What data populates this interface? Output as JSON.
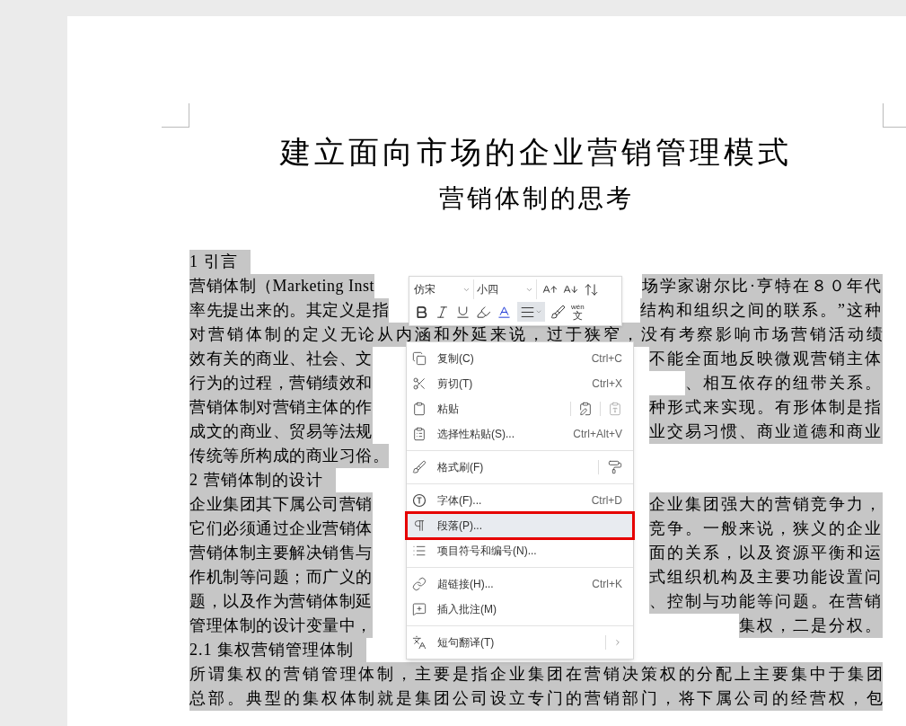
{
  "document": {
    "title": "建立面向市场的企业营销管理模式",
    "subtitle": "营销体制的思考",
    "lines": [
      {
        "kind": "heading",
        "text": "1 引言"
      },
      {
        "kind": "split",
        "left": "营销体制（Marketing Inst",
        "right": "场学家谢尔比·亨特在８０年代"
      },
      {
        "kind": "split",
        "left": "率先提出来的。其定义是指",
        "right": "结构和组织之间的联系。”这种"
      },
      {
        "kind": "full",
        "text": "对营销体制的定义无论从内涵和外延来说，过于狭窄，没有考察影响市场营销活动绩"
      },
      {
        "kind": "split",
        "left": "效有关的商业、社会、文",
        "right": "不能全面地反映微观营销主体"
      },
      {
        "kind": "split",
        "left": "行为的过程，营销绩效和",
        "right": "、相互依存的纽带关系。"
      },
      {
        "kind": "split",
        "left": "营销体制对营销主体的作",
        "right": "种形式来实现。有形体制是指"
      },
      {
        "kind": "split",
        "left": "成文的商业、贸易等法规",
        "right": "业交易习惯、商业道德和商业"
      },
      {
        "kind": "left",
        "text": "传统等所构成的商业习俗。"
      },
      {
        "kind": "heading",
        "text": "2 营销体制的设计"
      },
      {
        "kind": "split",
        "left": "企业集团其下属公司营销",
        "right": "企业集团强大的营销竞争力，"
      },
      {
        "kind": "split",
        "left": "它们必须通过企业营销体",
        "right": "竞争。一般来说，狭义的企业"
      },
      {
        "kind": "split",
        "left": "营销体制主要解决销售与",
        "right": "面的关系，以及资源平衡和运"
      },
      {
        "kind": "split",
        "left": "作机制等问题；而广义的",
        "right": "式组织机构及主要功能设置问"
      },
      {
        "kind": "split",
        "left": "题，以及作为营销体制延",
        "right": "、控制与功能等问题。在营销"
      },
      {
        "kind": "split",
        "left": "管理体制的设计变量中，",
        "right": "集权，二是分权。"
      },
      {
        "kind": "heading",
        "text": "2.1 集权营销管理体制"
      },
      {
        "kind": "full",
        "text": "所谓集权的营销管理体制，主要是指企业集团在营销决策权的分配上主要集中于集团"
      },
      {
        "kind": "full",
        "text": "总部。典型的集权体制就是集团公司设立专门的营销部门，将下属公司的经营权，包"
      }
    ]
  },
  "mini_toolbar": {
    "font": "仿宋",
    "size": "小四",
    "align_selected": true,
    "phonetic": {
      "pinyin": "wén",
      "char": "文"
    }
  },
  "context_menu": {
    "items": [
      {
        "kind": "item",
        "label": "复制(C)",
        "shortcut": "Ctrl+C",
        "selected": false,
        "submenu": false
      },
      {
        "kind": "item",
        "label": "剪切(T)",
        "shortcut": "Ctrl+X",
        "selected": false,
        "submenu": false
      },
      {
        "kind": "item",
        "label": "粘贴",
        "selected": false,
        "submenu": false
      },
      {
        "kind": "item",
        "label": "选择性粘贴(S)...",
        "shortcut": "Ctrl+Alt+V",
        "selected": false,
        "submenu": false
      },
      {
        "kind": "separator"
      },
      {
        "kind": "item",
        "label": "格式刷(F)",
        "selected": false,
        "submenu": false
      },
      {
        "kind": "separator"
      },
      {
        "kind": "item",
        "label": "字体(F)...",
        "shortcut": "Ctrl+D",
        "selected": false,
        "submenu": false
      },
      {
        "kind": "item",
        "label": "段落(P)...",
        "selected": true,
        "submenu": false
      },
      {
        "kind": "item",
        "label": "项目符号和编号(N)...",
        "selected": false,
        "submenu": false
      },
      {
        "kind": "separator"
      },
      {
        "kind": "item",
        "label": "超链接(H)...",
        "shortcut": "Ctrl+K",
        "selected": false,
        "submenu": false
      },
      {
        "kind": "item",
        "label": "插入批注(M)",
        "selected": false,
        "submenu": false
      },
      {
        "kind": "separator"
      },
      {
        "kind": "item",
        "label": "短句翻译(T)",
        "selected": false,
        "submenu": true
      }
    ]
  }
}
